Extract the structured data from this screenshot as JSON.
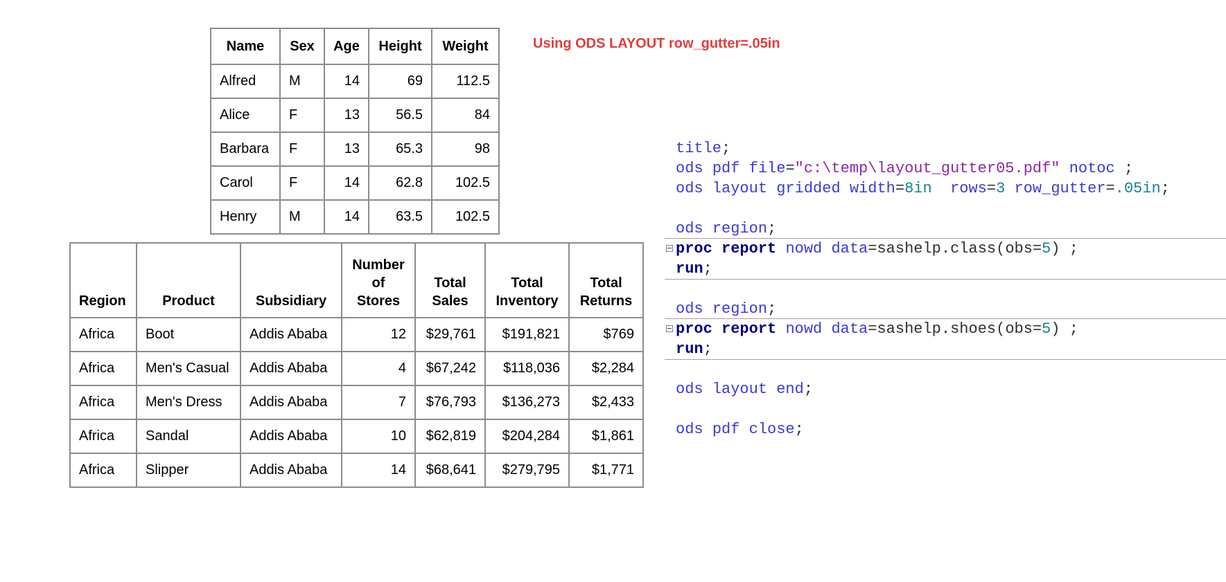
{
  "caption": "Using ODS LAYOUT row_gutter=.05in",
  "class_table": {
    "headers": [
      "Name",
      "Sex",
      "Age",
      "Height",
      "Weight"
    ],
    "rows": [
      [
        "Alfred",
        "M",
        "14",
        "69",
        "112.5"
      ],
      [
        "Alice",
        "F",
        "13",
        "56.5",
        "84"
      ],
      [
        "Barbara",
        "F",
        "13",
        "65.3",
        "98"
      ],
      [
        "Carol",
        "F",
        "14",
        "62.8",
        "102.5"
      ],
      [
        "Henry",
        "M",
        "14",
        "63.5",
        "102.5"
      ]
    ]
  },
  "shoes_table": {
    "headers": [
      "Region",
      "Product",
      "Subsidiary",
      "Number of Stores",
      "Total Sales",
      "Total Inventory",
      "Total Returns"
    ],
    "rows": [
      [
        "Africa",
        "Boot",
        "Addis Ababa",
        "12",
        "$29,761",
        "$191,821",
        "$769"
      ],
      [
        "Africa",
        "Men's Casual",
        "Addis Ababa",
        "4",
        "$67,242",
        "$118,036",
        "$2,284"
      ],
      [
        "Africa",
        "Men's Dress",
        "Addis Ababa",
        "7",
        "$76,793",
        "$136,273",
        "$2,433"
      ],
      [
        "Africa",
        "Sandal",
        "Addis Ababa",
        "10",
        "$62,819",
        "$204,284",
        "$1,861"
      ],
      [
        "Africa",
        "Slipper",
        "Addis Ababa",
        "14",
        "$68,641",
        "$279,795",
        "$1,771"
      ]
    ]
  },
  "code_lines": [
    "title;",
    "ods pdf file=\"c:\\temp\\layout_gutter05.pdf\" notoc ;",
    "ods layout gridded width=8in  rows=3 row_gutter=.05in;",
    "",
    "ods region;",
    "proc report nowd data=sashelp.class(obs=5) ;",
    "run;",
    "",
    "ods region;",
    "proc report nowd data=sashelp.shoes(obs=5) ;",
    "run;",
    "",
    "ods layout end;",
    "",
    "ods pdf close;"
  ],
  "colors": {
    "caption": "#e53b3b",
    "keyword": "#3a3ad6",
    "string": "#8b2aa3",
    "number": "#14838b",
    "proc_keyword": "#000080",
    "table_border": "#8c8c8c"
  }
}
